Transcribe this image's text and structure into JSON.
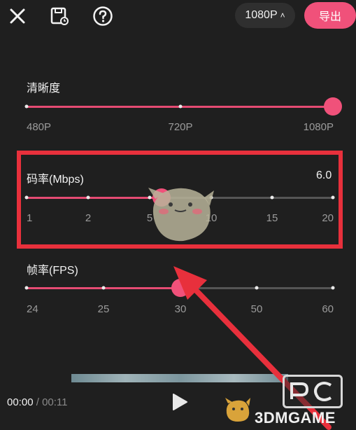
{
  "top_bar": {
    "resolution_button": "1080P",
    "export_button": "导出"
  },
  "resolution": {
    "label": "清晰度",
    "ticks": [
      "480P",
      "720P",
      "1080P"
    ],
    "selected": "1080P"
  },
  "bitrate": {
    "label": "码率(Mbps)",
    "value": "6.0",
    "ticks": [
      "1",
      "2",
      "5",
      "10",
      "15",
      "20"
    ],
    "selected_fraction": 0.45
  },
  "framerate": {
    "label": "帧率(FPS)",
    "ticks": [
      "24",
      "25",
      "30",
      "50",
      "60"
    ],
    "selected": "30"
  },
  "player": {
    "current_time": "00:00",
    "separator": " / ",
    "total_time": "00:11"
  },
  "watermark": "3DMGAME",
  "colors": {
    "accent": "#f0517a",
    "highlight": "#e8303c",
    "background": "#1f1f1f"
  }
}
